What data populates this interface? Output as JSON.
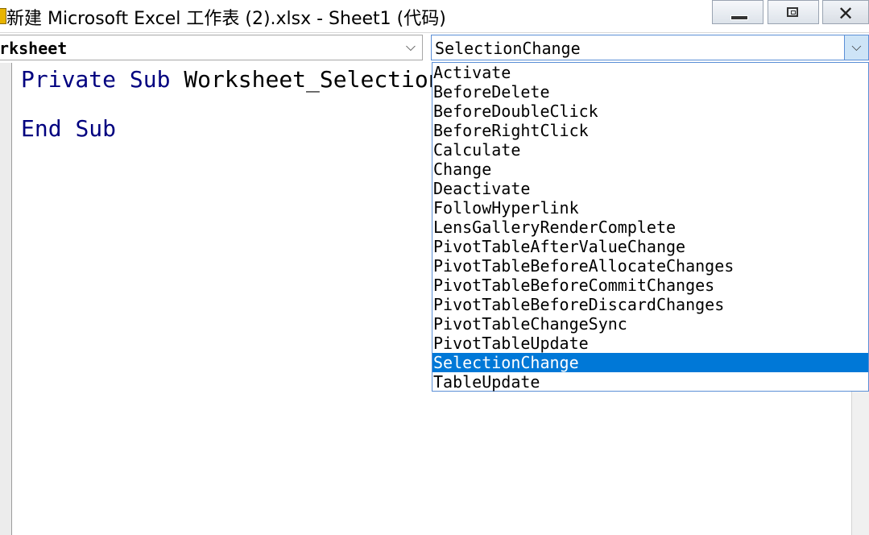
{
  "window": {
    "title": "新建 Microsoft Excel 工作表 (2).xlsx - Sheet1 (代码)",
    "close_glyph": "✕"
  },
  "object_combo": {
    "value": "orksheet",
    "arrow": "⌵"
  },
  "procedure_combo": {
    "value": "SelectionChange",
    "arrow": "⌵"
  },
  "code": {
    "line1_kw1": "Private",
    "line1_kw2": "Sub",
    "line1_rest": "Worksheet_SelectionC",
    "line2_kw1": "End",
    "line2_kw2": "Sub"
  },
  "dropdown": {
    "items": [
      "Activate",
      "BeforeDelete",
      "BeforeDoubleClick",
      "BeforeRightClick",
      "Calculate",
      "Change",
      "Deactivate",
      "FollowHyperlink",
      "LensGalleryRenderComplete",
      "PivotTableAfterValueChange",
      "PivotTableBeforeAllocateChanges",
      "PivotTableBeforeCommitChanges",
      "PivotTableBeforeDiscardChanges",
      "PivotTableChangeSync",
      "PivotTableUpdate",
      "SelectionChange",
      "TableUpdate"
    ],
    "selected": "SelectionChange"
  },
  "colors": {
    "keyword": "#00007f",
    "selection": "#0078d7",
    "dropdown_border": "#5b8fd6"
  }
}
